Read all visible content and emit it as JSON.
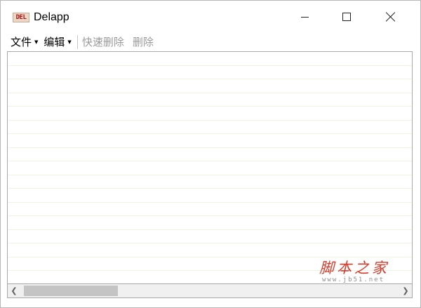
{
  "window": {
    "icon_text": "DEL",
    "title": "Delapp"
  },
  "menubar": {
    "file_label": "文件",
    "edit_label": "编辑",
    "quick_delete_label": "快速删除",
    "delete_label": "删除"
  },
  "watermark": {
    "title": "脚本之家",
    "url": "www.jb51.net"
  },
  "icons": {
    "minimize": "minimize-icon",
    "maximize": "maximize-icon",
    "close": "close-icon",
    "scroll_left": "chevron-left-icon",
    "scroll_right": "chevron-right-icon"
  },
  "colors": {
    "watermark_red": "#d83a2a",
    "disabled_text": "#9a9a9a",
    "row_line": "#f0f2e2"
  }
}
